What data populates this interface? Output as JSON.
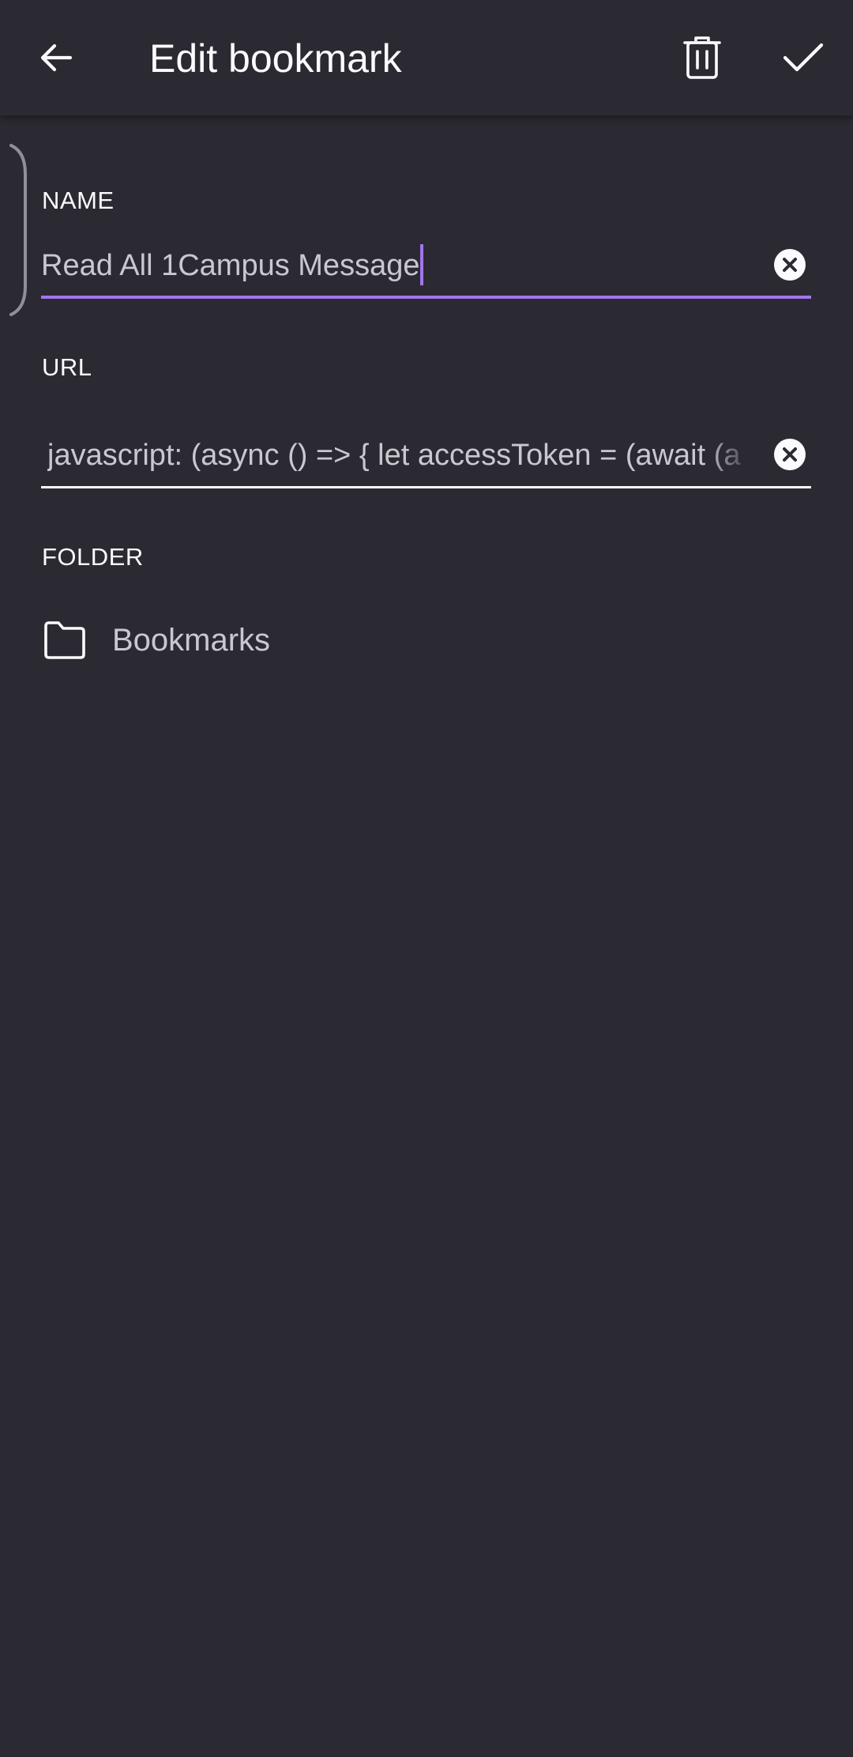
{
  "toolbar": {
    "title": "Edit bookmark",
    "back_icon": "arrow-left-icon",
    "delete_icon": "trash-icon",
    "save_icon": "check-icon"
  },
  "form": {
    "name_label": "NAME",
    "name_value": "Read All 1Campus Message",
    "url_label": "URL",
    "url_value": "javascript: (async () => { let accessToken = (await (a",
    "folder_label": "FOLDER",
    "folder_value": "Bookmarks"
  },
  "colors": {
    "background": "#2b2a33",
    "accent": "#a374ee",
    "text_primary": "#fbfbfe",
    "text_secondary": "#c9c8d0"
  }
}
